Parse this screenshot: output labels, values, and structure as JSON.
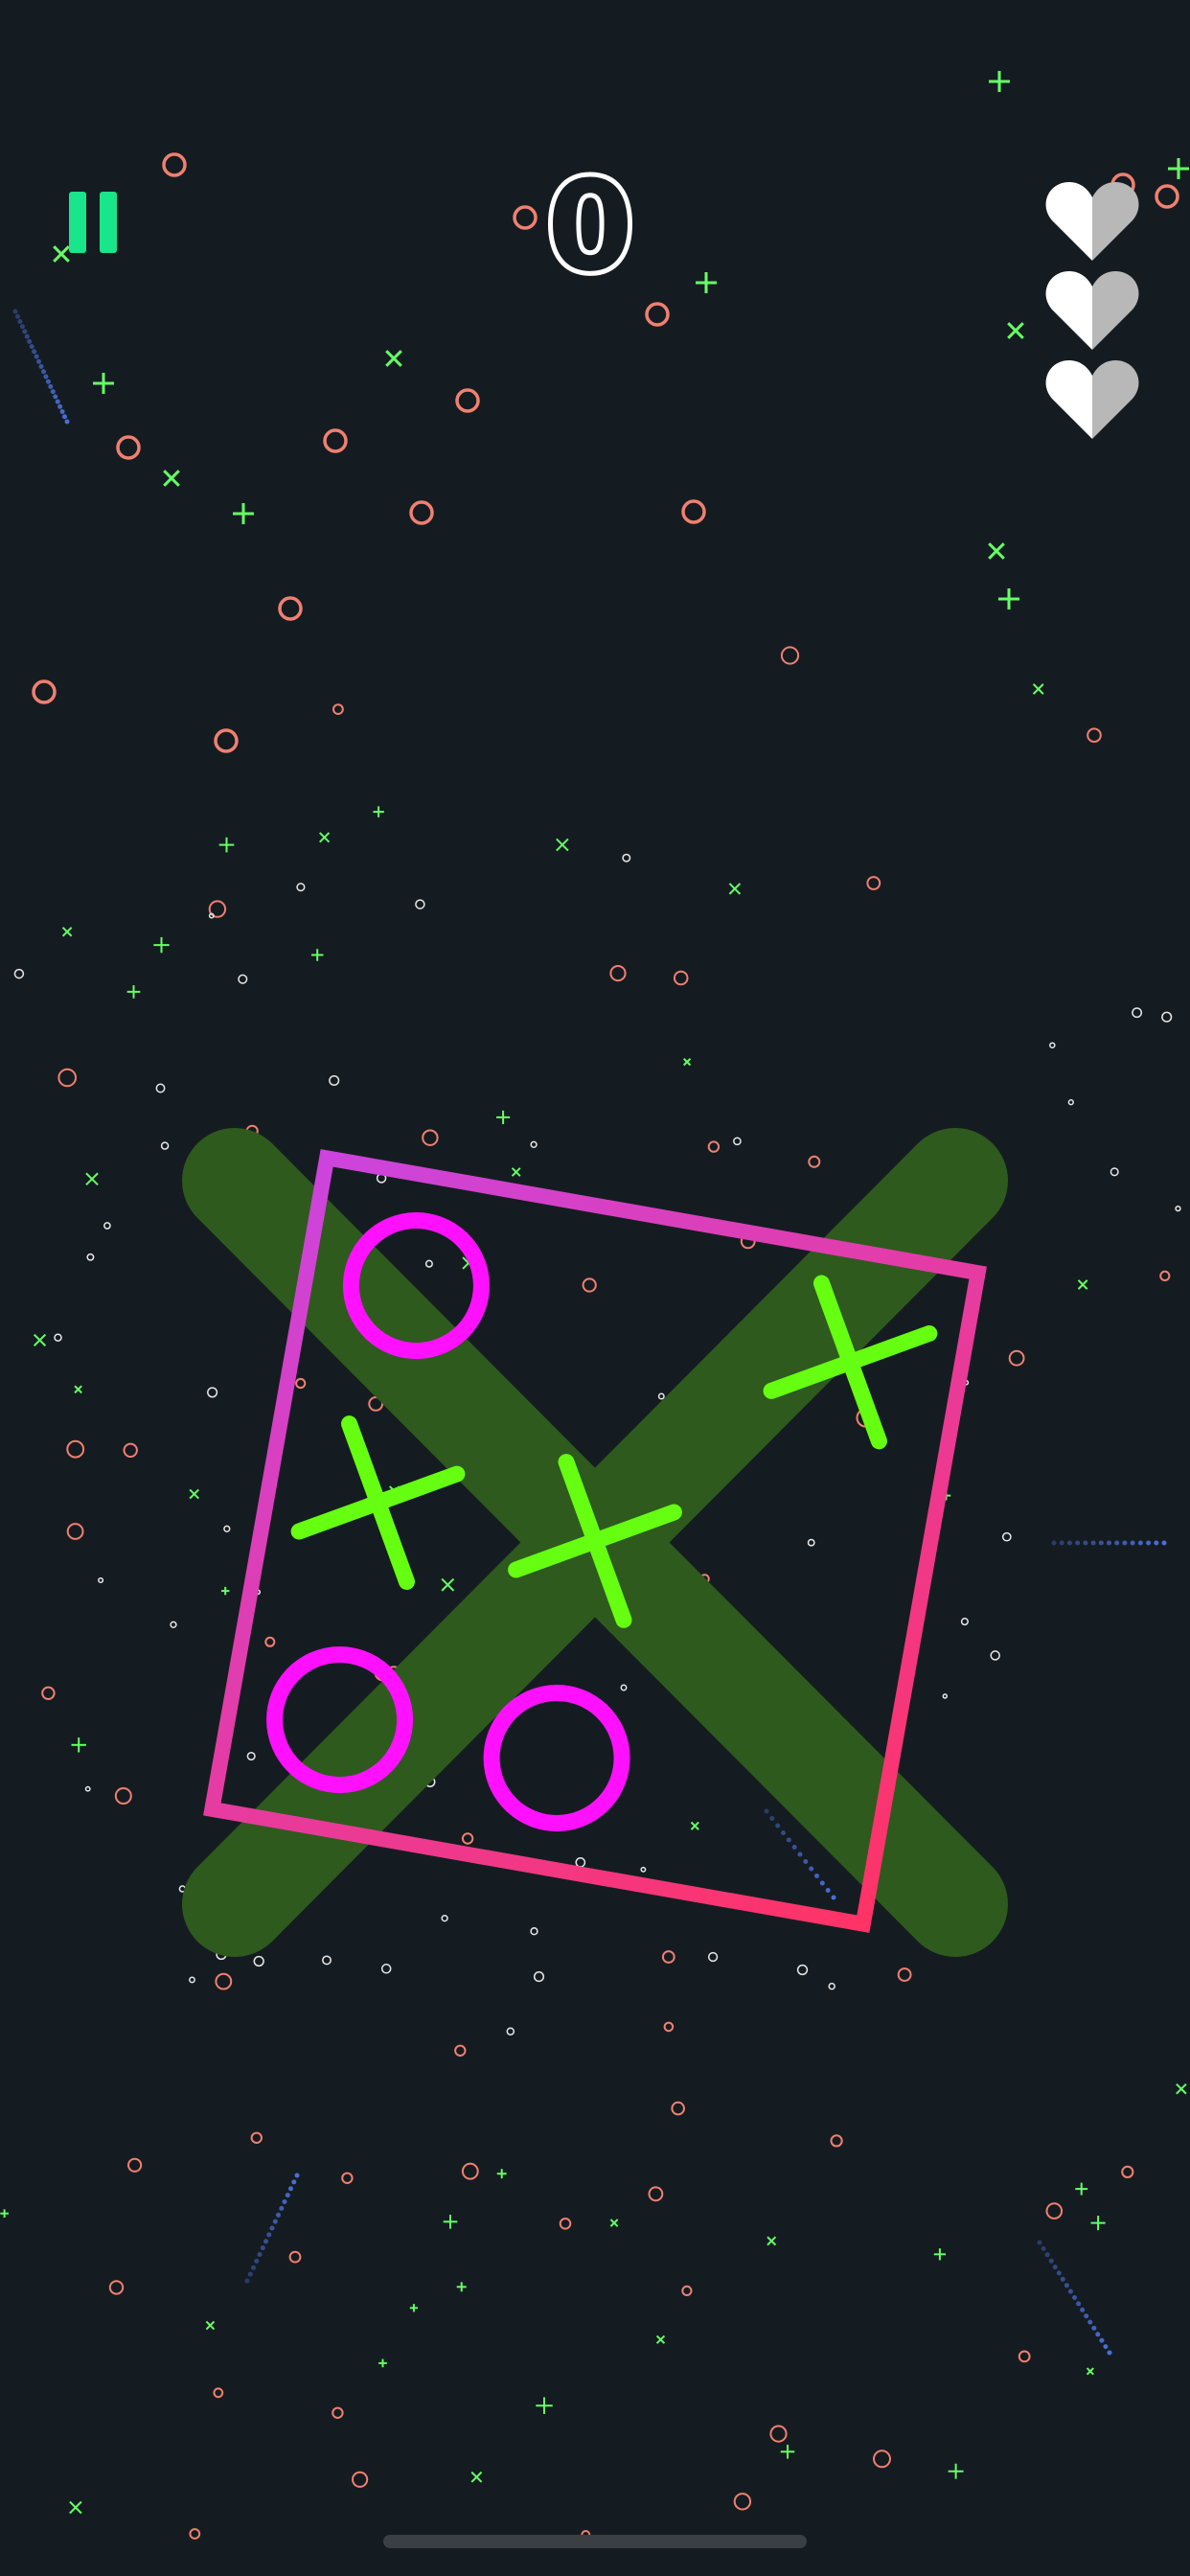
{
  "game": {
    "score": "0",
    "lives": 3,
    "max_lives": 3
  },
  "hud": {
    "pause_icon": "pause-icon",
    "heart_icon": "heart-icon"
  },
  "board": {
    "cells": [
      [
        "O",
        "",
        "X"
      ],
      [
        "X",
        "X",
        ""
      ],
      [
        "O",
        "O",
        ""
      ]
    ],
    "winning_line": "diagonal-x",
    "rotation_degrees": 10
  },
  "colors": {
    "background": "#151c21",
    "pause": "#19e58a",
    "x_mark": "#66ff11",
    "o_mark": "#ff11ff",
    "grid_gradient_start": "#cc44dd",
    "grid_gradient_end": "#ff3366",
    "winning_x": "#2e5a1e",
    "heart_light": "#ffffff",
    "heart_shade": "#b8b8b8",
    "particle_o": "#f08070",
    "particle_x": "#66ff66",
    "trail": "#4a6fd8"
  }
}
